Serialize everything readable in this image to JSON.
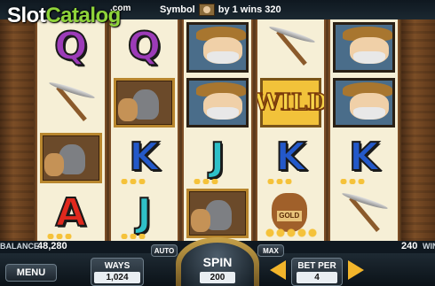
{
  "logo": {
    "slot": "Slot",
    "catalog": "Catalog",
    "com": ".com"
  },
  "win_message": {
    "prefix": "Symbol",
    "suffix": "by 1 wins 320",
    "symbol_icon": "donkey-icon"
  },
  "reels": [
    [
      "Q",
      "pickaxe",
      "donkey",
      "A"
    ],
    [
      "Q",
      "donkey",
      "K",
      "J"
    ],
    [
      "miner",
      "miner",
      "J",
      "donkey"
    ],
    [
      "pickaxe",
      "WILD",
      "K",
      "bag"
    ],
    [
      "miner",
      "miner",
      "K",
      "pickaxe"
    ]
  ],
  "bag_label": "GOLD",
  "info": {
    "balance_label": "BALANCE",
    "balance_value": "48,280",
    "win_value": "240",
    "win_label": "WIN"
  },
  "controls": {
    "menu": "MENU",
    "ways_label": "WAYS",
    "ways_value": "1,024",
    "auto": "AUTO",
    "spin": "SPIN",
    "spin_value": "200",
    "max": "MAX",
    "bet_per_label": "BET PER",
    "bet_per_value": "4"
  },
  "colors": {
    "accent": "#f2b52b",
    "q": "#9c3bb8",
    "k": "#2459c9",
    "j": "#2fc0c8",
    "a": "#e0281d"
  }
}
